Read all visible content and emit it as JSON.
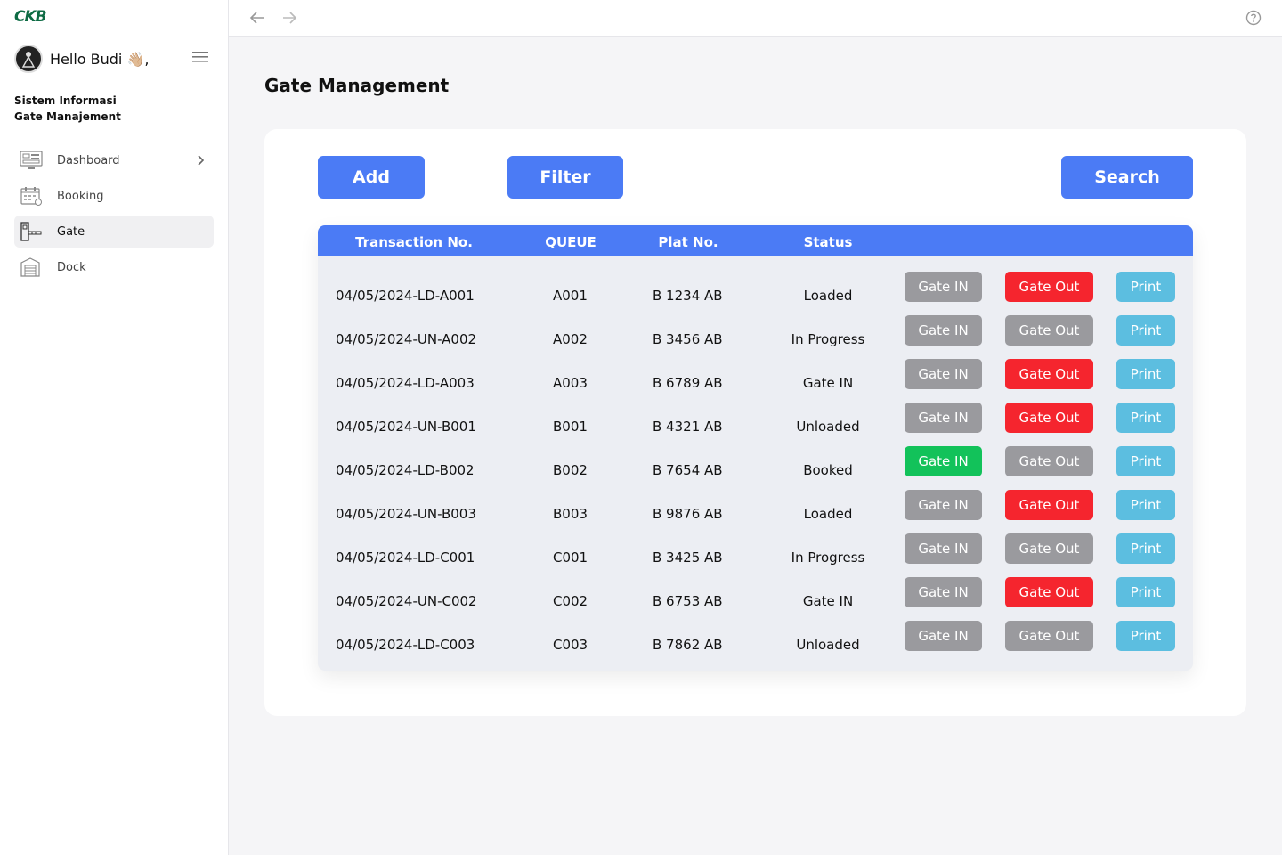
{
  "brand": {
    "logo_text": "CKB"
  },
  "user": {
    "greeting": "Hello Budi 👋🏼,"
  },
  "app": {
    "name_line1": "Sistem Informasi",
    "name_line2": "Gate Manajement"
  },
  "sidebar": {
    "items": [
      {
        "label": "Dashboard",
        "icon": "dashboard-icon",
        "active": false,
        "has_chevron": true
      },
      {
        "label": "Booking",
        "icon": "booking-icon",
        "active": false,
        "has_chevron": false
      },
      {
        "label": "Gate",
        "icon": "gate-icon",
        "active": true,
        "has_chevron": false
      },
      {
        "label": "Dock",
        "icon": "dock-icon",
        "active": false,
        "has_chevron": false
      }
    ]
  },
  "page": {
    "title": "Gate Management"
  },
  "toolbar": {
    "add_label": "Add",
    "filter_label": "Filter",
    "search_label": "Search"
  },
  "table": {
    "headers": [
      "Transaction No.",
      "QUEUE",
      "Plat No.",
      "Status"
    ],
    "rows": [
      {
        "transaction": "04/05/2024-LD-A001",
        "queue": "A001",
        "plate": "B 1234 AB",
        "status": "Loaded",
        "gate_in": "Gate IN",
        "gate_in_state": "disabled",
        "gate_out": "Gate Out",
        "gate_out_state": "active",
        "print": "Print"
      },
      {
        "transaction": "04/05/2024-UN-A002",
        "queue": "A002",
        "plate": "B 3456 AB",
        "status": "In Progress",
        "gate_in": "Gate IN",
        "gate_in_state": "disabled",
        "gate_out": "Gate Out",
        "gate_out_state": "disabled",
        "print": "Print"
      },
      {
        "transaction": "04/05/2024-LD-A003",
        "queue": "A003",
        "plate": "B 6789 AB",
        "status": "Gate IN",
        "gate_in": "Gate IN",
        "gate_in_state": "disabled",
        "gate_out": "Gate Out",
        "gate_out_state": "active",
        "print": "Print"
      },
      {
        "transaction": "04/05/2024-UN-B001",
        "queue": "B001",
        "plate": "B 4321 AB",
        "status": "Unloaded",
        "gate_in": "Gate IN",
        "gate_in_state": "disabled",
        "gate_out": "Gate Out",
        "gate_out_state": "active",
        "print": "Print"
      },
      {
        "transaction": "04/05/2024-LD-B002",
        "queue": "B002",
        "plate": "B 7654 AB",
        "status": "Booked",
        "gate_in": "Gate IN",
        "gate_in_state": "active",
        "gate_out": "Gate Out",
        "gate_out_state": "disabled",
        "print": "Print"
      },
      {
        "transaction": "04/05/2024-UN-B003",
        "queue": "B003",
        "plate": "B 9876 AB",
        "status": "Loaded",
        "gate_in": "Gate IN",
        "gate_in_state": "disabled",
        "gate_out": "Gate Out",
        "gate_out_state": "active",
        "print": "Print"
      },
      {
        "transaction": "04/05/2024-LD-C001",
        "queue": "C001",
        "plate": "B 3425 AB",
        "status": "In Progress",
        "gate_in": "Gate IN",
        "gate_in_state": "disabled",
        "gate_out": "Gate Out",
        "gate_out_state": "disabled",
        "print": "Print"
      },
      {
        "transaction": "04/05/2024-UN-C002",
        "queue": "C002",
        "plate": "B 6753 AB",
        "status": "Gate IN",
        "gate_in": "Gate IN",
        "gate_in_state": "disabled",
        "gate_out": "Gate Out",
        "gate_out_state": "active",
        "print": "Print"
      },
      {
        "transaction": "04/05/2024-LD-C003",
        "queue": "C003",
        "plate": "B 7862 AB",
        "status": "Unloaded",
        "gate_in": "Gate IN",
        "gate_in_state": "disabled",
        "gate_out": "Gate Out",
        "gate_out_state": "disabled",
        "print": "Print"
      }
    ]
  },
  "colors": {
    "primary": "#4b7bf5",
    "gate_in_active": "#12c25a",
    "gate_out_active": "#f5252e",
    "disabled": "#9a9a9e",
    "print": "#5cbee0",
    "brand_green": "#0e6b44"
  },
  "icons": {
    "back": "arrow-left-icon",
    "forward": "arrow-right-icon",
    "help": "help-circle-icon",
    "menu": "hamburger-menu-icon"
  }
}
